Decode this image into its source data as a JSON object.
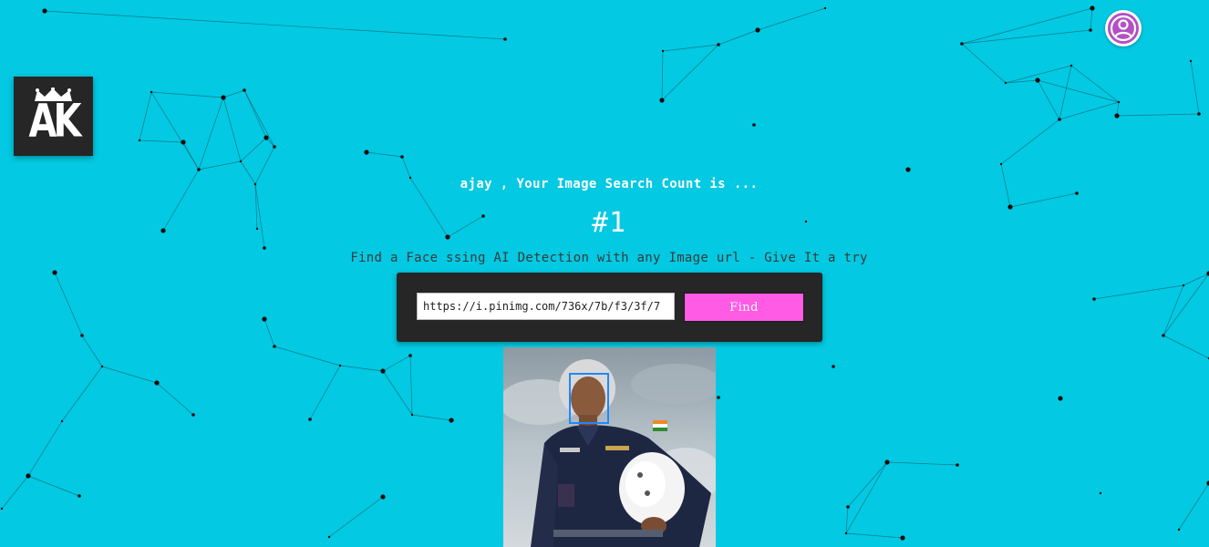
{
  "header": {
    "logo_text": "AK",
    "profile_icon": "user-circle-icon"
  },
  "main": {
    "greeting": "ajay , Your Image Search Count is ...",
    "search_count": "#1",
    "tagline": "Find a Face ssing AI Detection with any Image url - Give It a try"
  },
  "search": {
    "url_value": "https://i.pinimg.com/736x/7b/f3/3f/7",
    "find_label": "Find"
  },
  "result": {
    "face_detected": true
  },
  "colors": {
    "background": "#03c9e2",
    "panel": "#262626",
    "find_button": "#ff5be5",
    "face_box": "#1e88ff",
    "avatar_icon": "#b44fc6"
  }
}
